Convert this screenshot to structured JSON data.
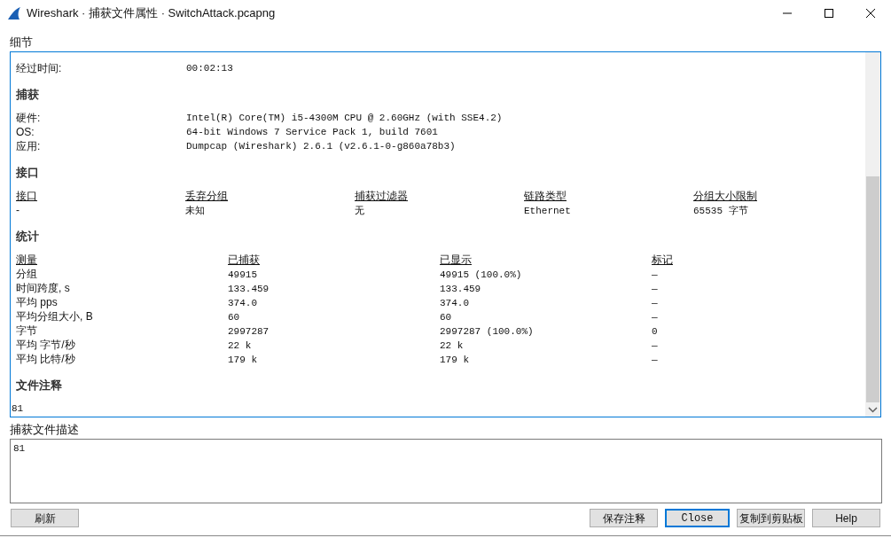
{
  "window": {
    "title": "Wireshark · 捕获文件属性 · SwitchAttack.pcapng"
  },
  "details": {
    "label": "细节",
    "elapsed": {
      "label": "经过时间:",
      "value": "00:02:13"
    },
    "capture": {
      "heading": "捕获",
      "rows": [
        {
          "label": "硬件:",
          "value": "Intel(R) Core(TM) i5-4300M CPU @ 2.60GHz (with SSE4.2)"
        },
        {
          "label": "OS:",
          "value": "64-bit Windows 7 Service Pack 1, build 7601"
        },
        {
          "label": "应用:",
          "value": "Dumpcap (Wireshark) 2.6.1 (v2.6.1-0-g860a78b3)"
        }
      ]
    },
    "interfaces": {
      "heading": "接口",
      "columns": [
        "接口",
        "丢弃分组",
        "捕获过滤器",
        "链路类型",
        "分组大小限制"
      ],
      "rows": [
        [
          "-",
          "未知",
          "无",
          "Ethernet",
          "65535 字节"
        ]
      ]
    },
    "statistics": {
      "heading": "统计",
      "columns": [
        "测量",
        "已捕获",
        "已显示",
        "标记"
      ],
      "rows": [
        [
          "分组",
          "49915",
          "49915 (100.0%)",
          "—"
        ],
        [
          "时间跨度, s",
          "133.459",
          "133.459",
          "—"
        ],
        [
          "平均 pps",
          "374.0",
          "374.0",
          "—"
        ],
        [
          "平均分组大小, B",
          "60",
          "60",
          "—"
        ],
        [
          "字节",
          "2997287",
          "2997287 (100.0%)",
          "0"
        ],
        [
          "平均 字节/秒",
          "22 k",
          "22 k",
          "—"
        ],
        [
          "平均 比特/秒",
          "179 k",
          "179 k",
          "—"
        ]
      ]
    },
    "file_comments": {
      "heading": "文件注释",
      "text": "81"
    }
  },
  "description": {
    "label": "捕获文件描述",
    "value": "81"
  },
  "left_buttons": [
    {
      "label": "刷新",
      "default": false
    }
  ],
  "right_buttons": [
    {
      "label": "保存注释",
      "default": false
    },
    {
      "label": "Close",
      "default": true
    },
    {
      "label": "复制到剪贴板",
      "default": false
    },
    {
      "label": "Help",
      "default": false
    }
  ]
}
